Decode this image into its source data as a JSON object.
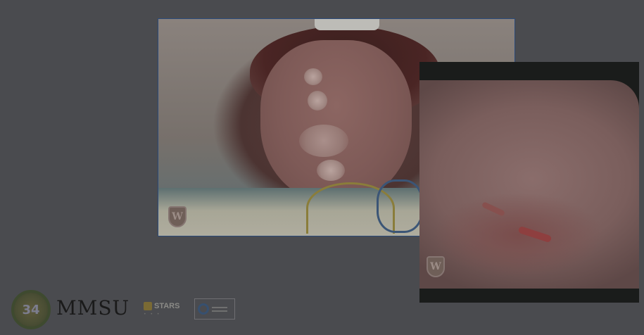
{
  "images": {
    "tongue_photo": {
      "watermark": "W"
    },
    "mucosa_photo": {
      "watermark": "W"
    }
  },
  "footer": {
    "seal_text": "34",
    "brand_name": "MMSU",
    "stars": {
      "title": "STARS",
      "subtitle": "",
      "dots": "• • •"
    },
    "accreditation": {
      "label": ""
    }
  }
}
